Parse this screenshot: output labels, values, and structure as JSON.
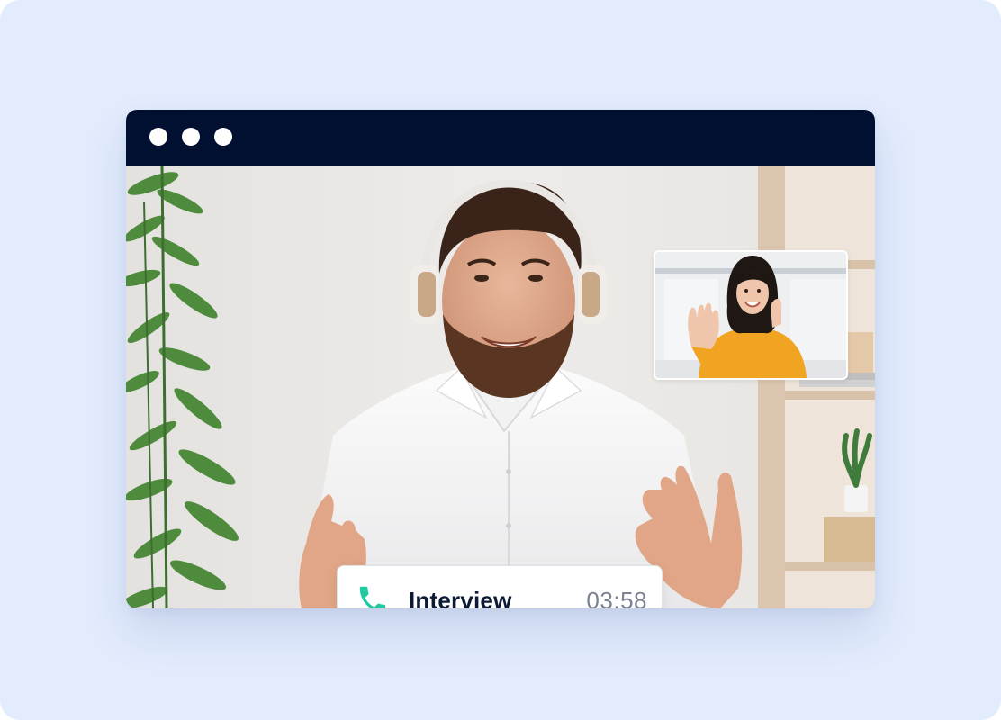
{
  "window": {
    "titlebar_color": "#010f31",
    "controls": [
      "window-dot",
      "window-dot",
      "window-dot"
    ]
  },
  "video": {
    "main_participant": "man-with-headphones",
    "pip_participant": "woman-waving"
  },
  "call": {
    "icon": "phone-icon",
    "icon_color": "#21c8a0",
    "title": "Interview",
    "duration": "03:58"
  }
}
